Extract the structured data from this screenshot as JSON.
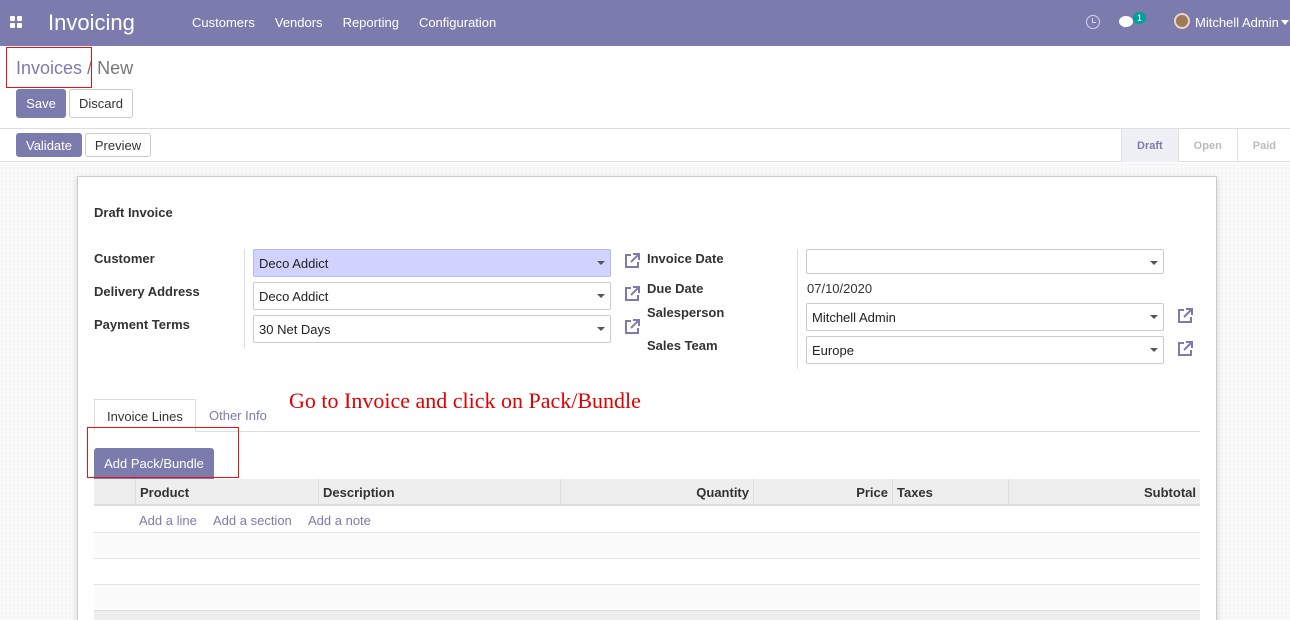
{
  "navbar": {
    "brand": "Invoicing",
    "menu": [
      "Customers",
      "Vendors",
      "Reporting",
      "Configuration"
    ],
    "chat_count": "1",
    "user": "Mitchell Admin"
  },
  "breadcrumb": {
    "parent": "Invoices",
    "separator": "/",
    "current": "New"
  },
  "actions": {
    "save": "Save",
    "discard": "Discard"
  },
  "header_buttons": {
    "validate": "Validate",
    "preview": "Preview"
  },
  "status": [
    "Draft",
    "Open",
    "Paid"
  ],
  "form": {
    "title": "Draft Invoice",
    "customer_label": "Customer",
    "customer_value": "Deco Addict",
    "delivery_label": "Delivery Address",
    "delivery_value": "Deco Addict",
    "terms_label": "Payment Terms",
    "terms_value": "30 Net Days",
    "invoice_date_label": "Invoice Date",
    "invoice_date_value": "",
    "due_date_label": "Due Date",
    "due_date_value": "07/10/2020",
    "salesperson_label": "Salesperson",
    "salesperson_value": "Mitchell Admin",
    "team_label": "Sales Team",
    "team_value": "Europe"
  },
  "tabs": [
    "Invoice Lines",
    "Other Info"
  ],
  "annotation": "Go to Invoice and click on Pack/Bundle",
  "pack_button": "Add Pack/Bundle",
  "table": {
    "columns": [
      "Product",
      "Description",
      "Quantity",
      "Price",
      "Taxes",
      "Subtotal"
    ],
    "add_links": [
      "Add a line",
      "Add a section",
      "Add a note"
    ]
  },
  "colors": {
    "brand": "#7c7bad",
    "annotation": "#e00000"
  }
}
